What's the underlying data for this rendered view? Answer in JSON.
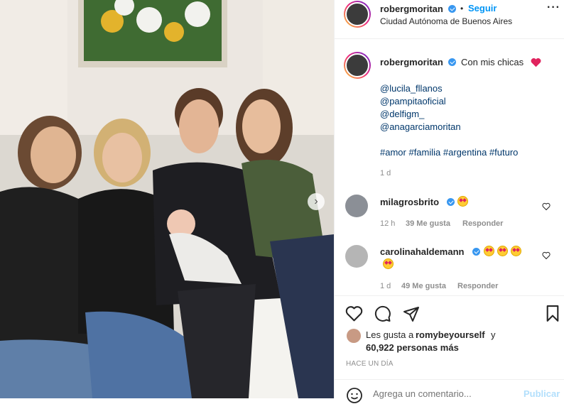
{
  "header": {
    "username": "robergmoritan",
    "follow_label": "Seguir",
    "dot": "•",
    "location": "Ciudad Autónoma de Buenos Aires",
    "more_icon": "more-icon"
  },
  "caption": {
    "username": "robergmoritan",
    "text": "Con mis chicas",
    "mentions": [
      "@lucila_fllanos",
      "@pampitaoficial",
      "@delfigm_",
      "@anagarciamoritan"
    ],
    "hashtags": "#amor #familia #argentina #futuro",
    "time": "1 d"
  },
  "comments": [
    {
      "username": "milagrosbrito",
      "time": "12 h",
      "likes": "39 Me gusta",
      "reply": "Responder"
    },
    {
      "username": "carolinahaldemann",
      "time": "1 d",
      "likes": "49 Me gusta",
      "reply": "Responder"
    }
  ],
  "actions": {
    "likes_prefix": "Les gusta a",
    "liker": "romybeyourself",
    "likes_suffix": "y",
    "others": "60,922 personas más",
    "timestamp": "HACE UN DÍA",
    "comment_placeholder": "Agrega un comentario...",
    "publish_label": "Publicar"
  },
  "colors": {
    "accent": "#0095f6",
    "link": "#00376b",
    "muted": "#8e8e8e",
    "heart": "#ed4956"
  }
}
